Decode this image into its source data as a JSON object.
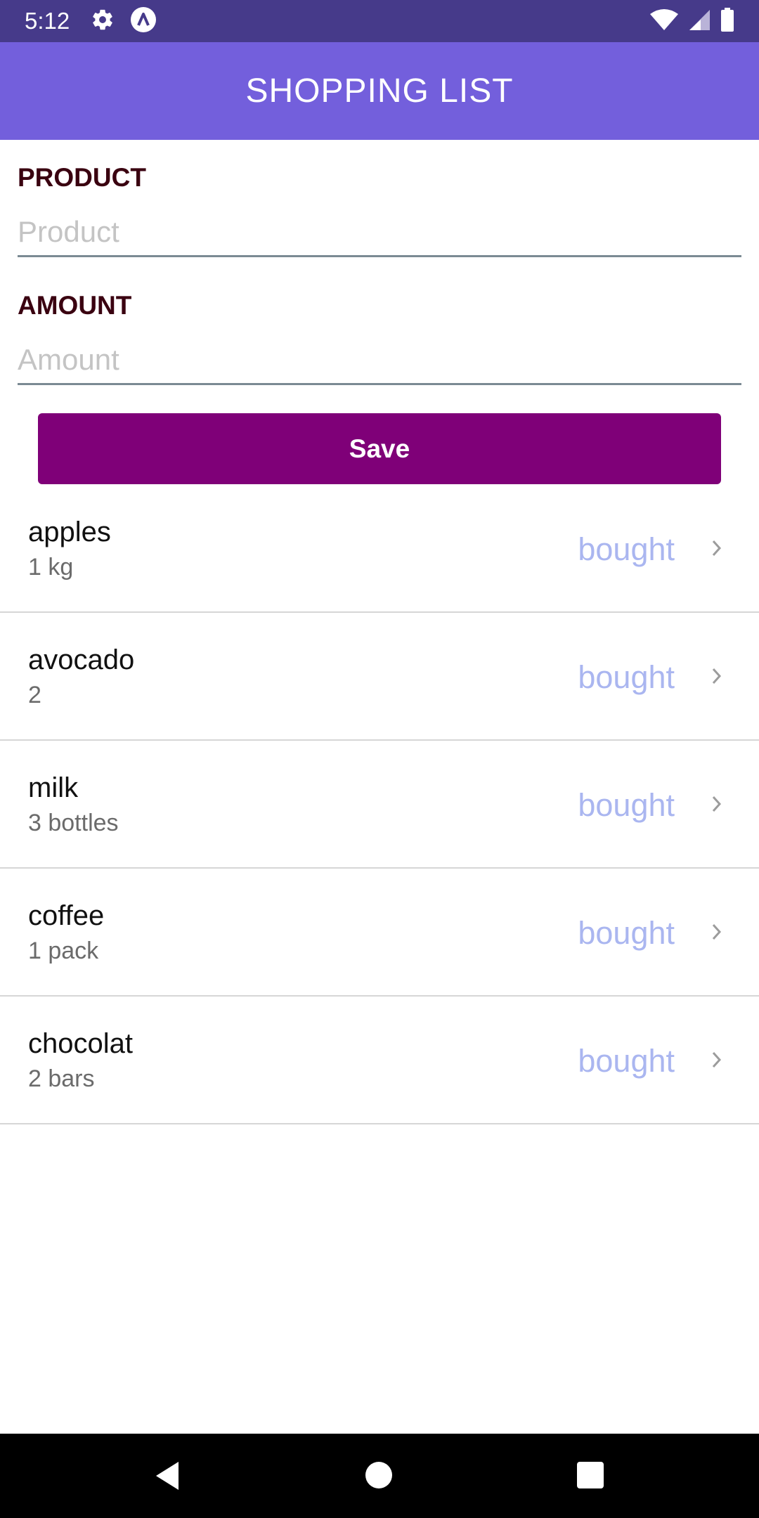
{
  "status_bar": {
    "time": "5:12",
    "icons_left": [
      "gear-icon",
      "app-logo-icon"
    ],
    "icons_right": [
      "wifi-icon",
      "cell-signal-icon",
      "battery-icon"
    ]
  },
  "app_bar": {
    "title": "SHOPPING LIST",
    "color": "#735fdc"
  },
  "form": {
    "product": {
      "label": "PRODUCT",
      "placeholder": "Product",
      "value": ""
    },
    "amount": {
      "label": "AMOUNT",
      "placeholder": "Amount",
      "value": ""
    },
    "save_label": "Save",
    "save_color": "#7f0078"
  },
  "items": [
    {
      "name": "apples",
      "amount": "1 kg",
      "status": "bought"
    },
    {
      "name": "avocado",
      "amount": "2",
      "status": "bought"
    },
    {
      "name": "milk",
      "amount": "3 bottles",
      "status": "bought"
    },
    {
      "name": "coffee",
      "amount": "1 pack",
      "status": "bought"
    },
    {
      "name": "chocolat",
      "amount": "2 bars",
      "status": "bought"
    }
  ],
  "nav_bar": {
    "icons": [
      "back-icon",
      "home-icon",
      "recent-apps-icon"
    ]
  }
}
